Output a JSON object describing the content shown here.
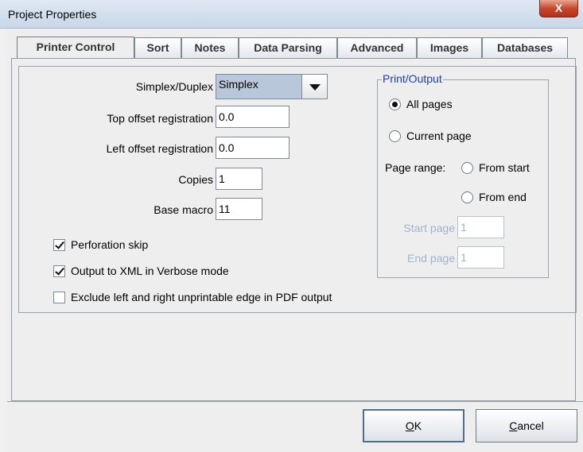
{
  "window": {
    "title": "Project Properties",
    "close_label": "X"
  },
  "tabs": [
    {
      "label": "Printer Control"
    },
    {
      "label": "Sort"
    },
    {
      "label": "Notes"
    },
    {
      "label": "Data Parsing"
    },
    {
      "label": "Advanced"
    },
    {
      "label": "Images"
    },
    {
      "label": "Databases"
    }
  ],
  "printer_control": {
    "simplex_duplex": {
      "label": "Simplex/Duplex",
      "value": "Simplex"
    },
    "top_offset": {
      "label": "Top offset registration",
      "value": "0.0"
    },
    "left_offset": {
      "label": "Left offset registration",
      "value": "0.0"
    },
    "copies": {
      "label": "Copies",
      "value": "1"
    },
    "base_macro": {
      "label": "Base macro",
      "value": "11"
    },
    "perforation_skip": {
      "label": "Perforation skip",
      "checked": true
    },
    "output_xml_verbose": {
      "label": "Output to XML in Verbose mode",
      "checked": true
    },
    "exclude_edge": {
      "label": "Exclude left and right unprintable edge in PDF output",
      "checked": false
    }
  },
  "print_output": {
    "title": "Print/Output",
    "all_pages": {
      "label": "All pages",
      "selected": true
    },
    "current_page": {
      "label": "Current page",
      "selected": false
    },
    "page_range_label": "Page range:",
    "from_start": {
      "label": "From start",
      "selected": false
    },
    "from_end": {
      "label": "From end",
      "selected": false
    },
    "start_page": {
      "label": "Start page",
      "value": "1"
    },
    "end_page": {
      "label": "End page",
      "value": "1"
    }
  },
  "buttons": {
    "ok": {
      "mnemonic": "O",
      "rest": "K"
    },
    "cancel": {
      "mnemonic": "C",
      "rest": "ancel"
    }
  },
  "colors": {
    "group_title": "#1d3fb8",
    "disabled_text": "#9fb4cf",
    "close_button": "#c8492d"
  }
}
